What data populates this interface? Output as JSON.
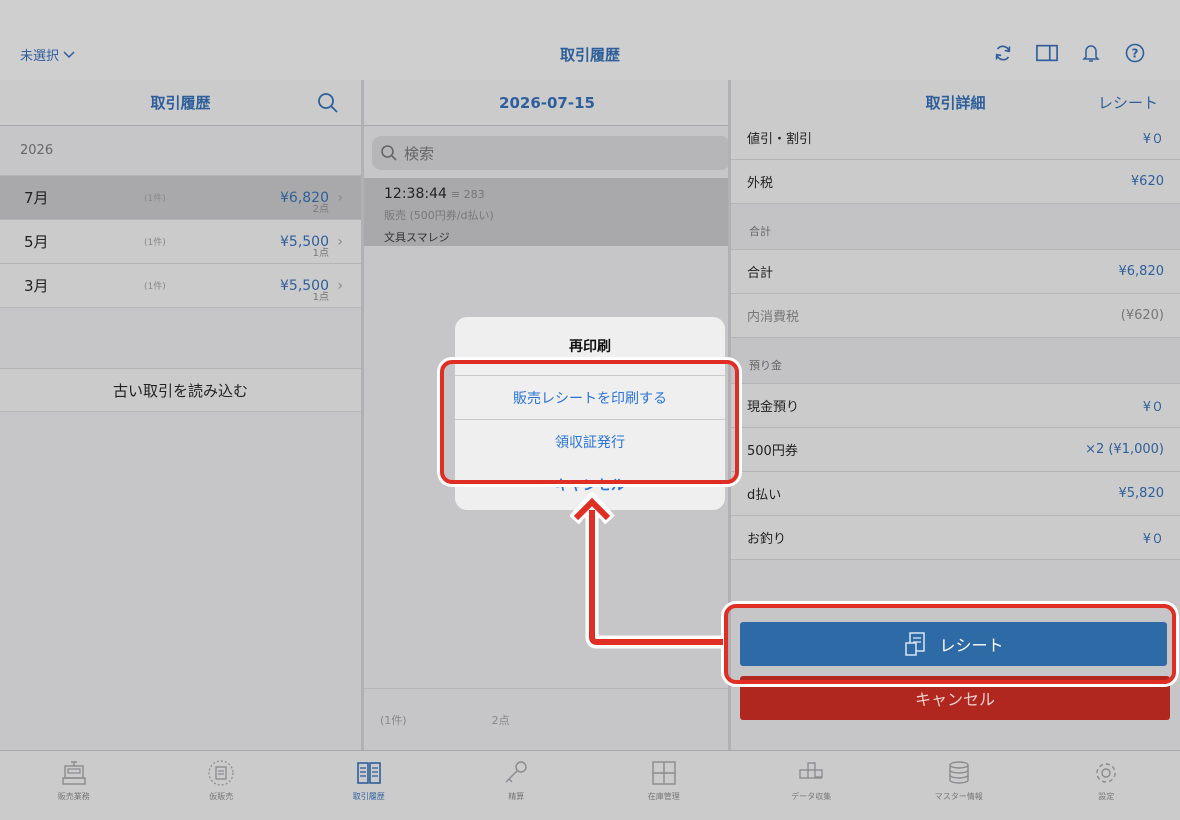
{
  "topbar": {
    "selector_label": "未選択",
    "title": "取引履歴"
  },
  "left": {
    "header": "取引履歴",
    "year": "2026",
    "months": [
      {
        "month": "7月",
        "count": "(1件)",
        "amount": "¥6,820",
        "points": "2点",
        "selected": true
      },
      {
        "month": "5月",
        "count": "(1件)",
        "amount": "¥5,500",
        "points": "1点",
        "selected": false
      },
      {
        "month": "3月",
        "count": "(1件)",
        "amount": "¥5,500",
        "points": "1点",
        "selected": false
      }
    ],
    "load_older": "古い取引を読み込む"
  },
  "mid": {
    "header": "2026-07-15",
    "search_placeholder": "検索",
    "transaction": {
      "time": "12:38:44",
      "number": "≡ 283",
      "detail": "販売 (500円券/d払い)",
      "store": "文具スマレジ"
    },
    "footer_count": "(1件)",
    "footer_points": "2点"
  },
  "right": {
    "header": "取引詳細",
    "receipt_link": "レシート",
    "rows_top": [
      {
        "label": "値引・割引",
        "value": "¥０"
      },
      {
        "label": "外税",
        "value": "¥620"
      }
    ],
    "section_total": "合計",
    "rows_total": [
      {
        "label": "合計",
        "value": "¥6,820",
        "muted": false
      },
      {
        "label": "内消費税",
        "value": "(¥620)",
        "muted": true
      }
    ],
    "section_deposit": "預り金",
    "rows_deposit": [
      {
        "label": "現金預り",
        "value": "¥０"
      },
      {
        "label": "500円券",
        "value": "×2 (¥1,000)"
      },
      {
        "label": "d払い",
        "value": "¥5,820"
      },
      {
        "label": "お釣り",
        "value": "¥０"
      }
    ],
    "receipt_button": "レシート",
    "cancel_button": "キャンセル"
  },
  "dialog": {
    "title": "再印刷",
    "option_1": "販売レシートを印刷する",
    "option_2": "領収証発行",
    "cancel": "キャンセル"
  },
  "tabs": [
    {
      "label": "販売業務",
      "icon": "register-icon",
      "active": false
    },
    {
      "label": "仮販売",
      "icon": "temp-sale-icon",
      "active": false
    },
    {
      "label": "取引履歴",
      "icon": "history-icon",
      "active": true
    },
    {
      "label": "精算",
      "icon": "key-icon",
      "active": false
    },
    {
      "label": "在庫管理",
      "icon": "inventory-icon",
      "active": false
    },
    {
      "label": "データ収集",
      "icon": "data-icon",
      "active": false
    },
    {
      "label": "マスター情報",
      "icon": "database-icon",
      "active": false
    },
    {
      "label": "設定",
      "icon": "gear-icon",
      "active": false
    }
  ],
  "colors": {
    "accent": "#2f5f9a",
    "link": "#2b74d3",
    "danger": "#b0271f",
    "highlight": "#e02e24"
  }
}
